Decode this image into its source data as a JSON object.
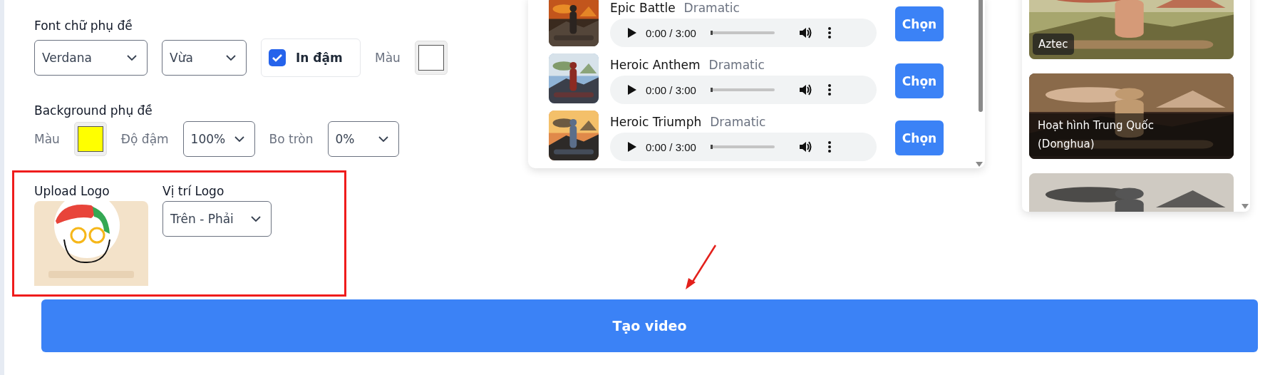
{
  "subtitle_font": {
    "label": "Font chữ phụ đề",
    "family": {
      "value": "Verdana"
    },
    "size": {
      "value": "Vừa"
    },
    "bold": {
      "label": "In đậm",
      "checked": true
    },
    "color_label": "Màu",
    "color": "#ffffff"
  },
  "subtitle_background": {
    "label": "Background phụ đề",
    "color_label": "Màu",
    "color": "#ffff00",
    "opacity_label": "Độ đậm",
    "opacity": {
      "value": "100%"
    },
    "radius_label": "Bo tròn",
    "radius": {
      "value": "0%"
    }
  },
  "logo": {
    "upload_label": "Upload Logo",
    "image": {
      "kind": "picture"
    },
    "position_label": "Vị trí Logo",
    "position": {
      "value": "Trên - Phải"
    }
  },
  "music_tracks": [
    {
      "title": "Epic Battle",
      "genre": "Dramatic",
      "time": "0:00 / 3:00",
      "level": 0,
      "button": "Chọn"
    },
    {
      "title": "Heroic Anthem",
      "genre": "Dramatic",
      "time": "0:00 / 3:00",
      "level": 0,
      "button": "Chọn"
    },
    {
      "title": "Heroic Triumph",
      "genre": "Dramatic",
      "time": "0:00 / 3:00",
      "level": 0,
      "button": "Chọn"
    }
  ],
  "styles": [
    {
      "kind": "picture",
      "caption": "Aztec"
    },
    {
      "kind": "picture",
      "caption": "Hoạt hình Trung Quốc (Donghua)"
    },
    {
      "kind": "picture"
    }
  ],
  "create_button": "Tạo video"
}
